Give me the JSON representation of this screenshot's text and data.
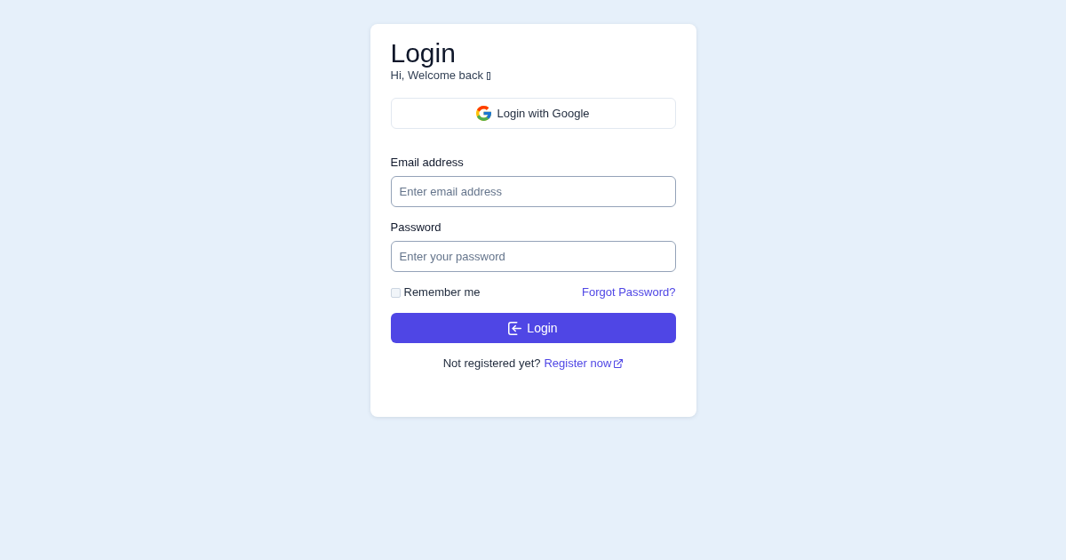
{
  "title": "Login",
  "subtitle": "Hi, Welcome back",
  "google_button": {
    "label": "Login with Google"
  },
  "fields": [
    {
      "label": "Email address",
      "placeholder": "Enter email address"
    },
    {
      "label": "Password",
      "placeholder": "Enter your password"
    }
  ],
  "remember": {
    "label": "Remember me",
    "checked": false
  },
  "forgot_link": "Forgot Password?",
  "submit_button": {
    "label": "Login"
  },
  "register": {
    "prompt": "Not registered yet?",
    "link": "Register now"
  }
}
